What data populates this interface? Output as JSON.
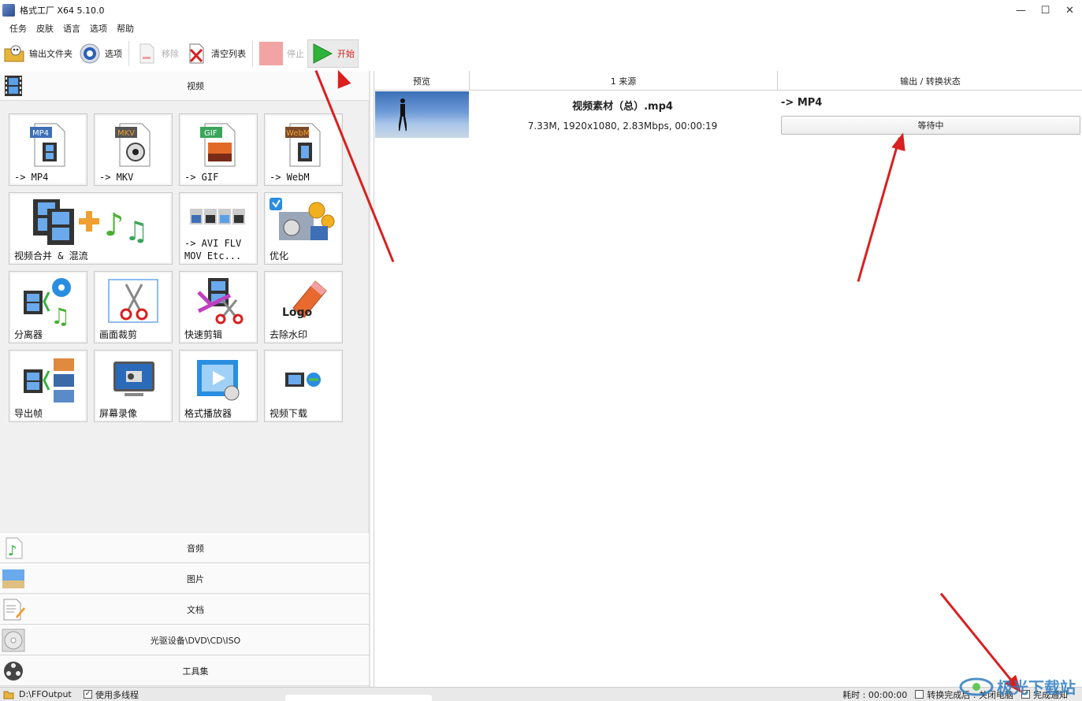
{
  "window": {
    "title": "格式工厂 X64 5.10.0",
    "minimize": "—",
    "maximize": "☐",
    "close": "✕"
  },
  "menu": [
    "任务",
    "皮肤",
    "语言",
    "选项",
    "帮助"
  ],
  "toolbar": {
    "output_folder": "输出文件夹",
    "options": "选项",
    "remove": "移除",
    "clear_list": "清空列表",
    "stop": "停止",
    "start": "开始"
  },
  "categories": {
    "video": "视频",
    "audio": "音频",
    "image": "图片",
    "document": "文档",
    "disc": "光驱设备\\DVD\\CD\\ISO",
    "tools": "工具集"
  },
  "video_tiles": [
    {
      "label": "-> MP4",
      "badge": "MP4",
      "badge_color": "#3d6fb7"
    },
    {
      "label": "-> MKV",
      "badge": "MKV",
      "badge_color": "#5a5a5a"
    },
    {
      "label": "-> GIF",
      "badge": "GIF",
      "badge_color": "#3aa55a"
    },
    {
      "label": "-> WebM",
      "badge": "WebM",
      "badge_color": "#7a4a2a"
    },
    {
      "label": "视频合并 & 混流"
    },
    {
      "label": "-> AVI FLV\nMOV Etc..."
    },
    {
      "label": "优化"
    },
    {
      "label": "分离器"
    },
    {
      "label": "画面裁剪"
    },
    {
      "label": "快速剪辑"
    },
    {
      "label": "去除水印",
      "art_text": "Logo"
    },
    {
      "label": "导出帧"
    },
    {
      "label": "屏幕录像"
    },
    {
      "label": "格式播放器"
    },
    {
      "label": "视频下载"
    }
  ],
  "table": {
    "headers": [
      "预览",
      "1 来源",
      "输出 / 转换状态"
    ],
    "rows": [
      {
        "name": "视频素材（总）.mp4",
        "info": "7.33M, 1920x1080, 2.83Mbps, 00:00:19",
        "output": "-> MP4",
        "status": "等待中"
      }
    ]
  },
  "statusbar": {
    "output_path": "D:\\FFOutput",
    "multithread": "使用多线程",
    "multithread_checked": "✓",
    "elapsed": "耗时 : 00:00:00",
    "after_done": "转换完成后 : 关闭电脑",
    "notify": "完成通知",
    "notify_checked": "✓"
  },
  "watermark": {
    "text": "极光下载站"
  },
  "colors": {
    "accent_red": "#d9201f",
    "start_green": "#2fb33a",
    "stop_red": "#f08a8a"
  }
}
